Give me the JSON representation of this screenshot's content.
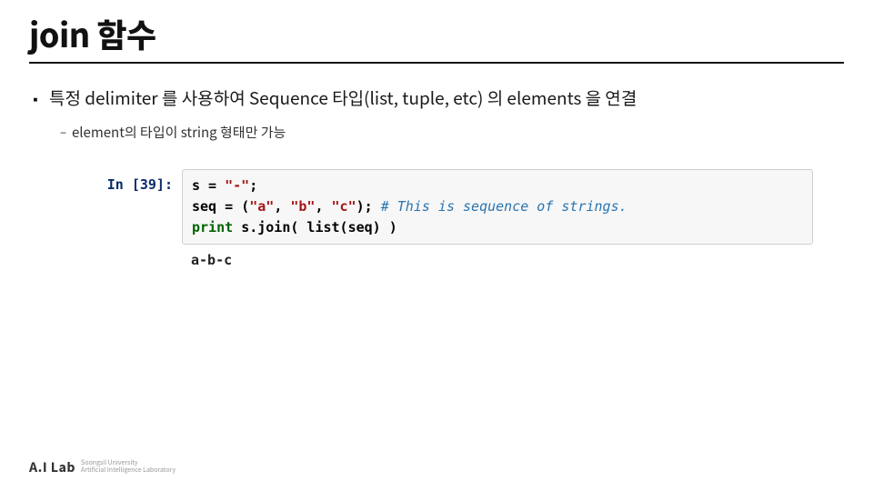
{
  "title": "join 함수",
  "bullet": {
    "mark": "▪",
    "text": "특정 delimiter 를 사용하여 Sequence 타입(list, tuple, etc) 의 elements 을 연결"
  },
  "subbullet": {
    "mark": "–",
    "text": "element의 타입이 string 형태만 가능"
  },
  "code": {
    "prompt": "In [39]:",
    "line1": {
      "var_s": "s",
      "eq1": " = ",
      "str_dash": "\"-\"",
      "semi1": ";"
    },
    "line2": {
      "var_seq": "seq",
      "eq2": " = ",
      "paren_open": "(",
      "str_a": "\"a\"",
      "comma1": ", ",
      "str_b": "\"b\"",
      "comma2": ", ",
      "str_c": "\"c\"",
      "paren_close": ")",
      "semi2": "; ",
      "comment": "# This is sequence of strings."
    },
    "line3": {
      "kw_print": "print",
      "space": " ",
      "expr": "s.join( list(seq) )"
    },
    "output": "a-b-c"
  },
  "footer": {
    "logo_main": "A.I Lab",
    "logo_sub1": "Soongsil University",
    "logo_sub2": "Artificial Intelligence Laboratory"
  }
}
